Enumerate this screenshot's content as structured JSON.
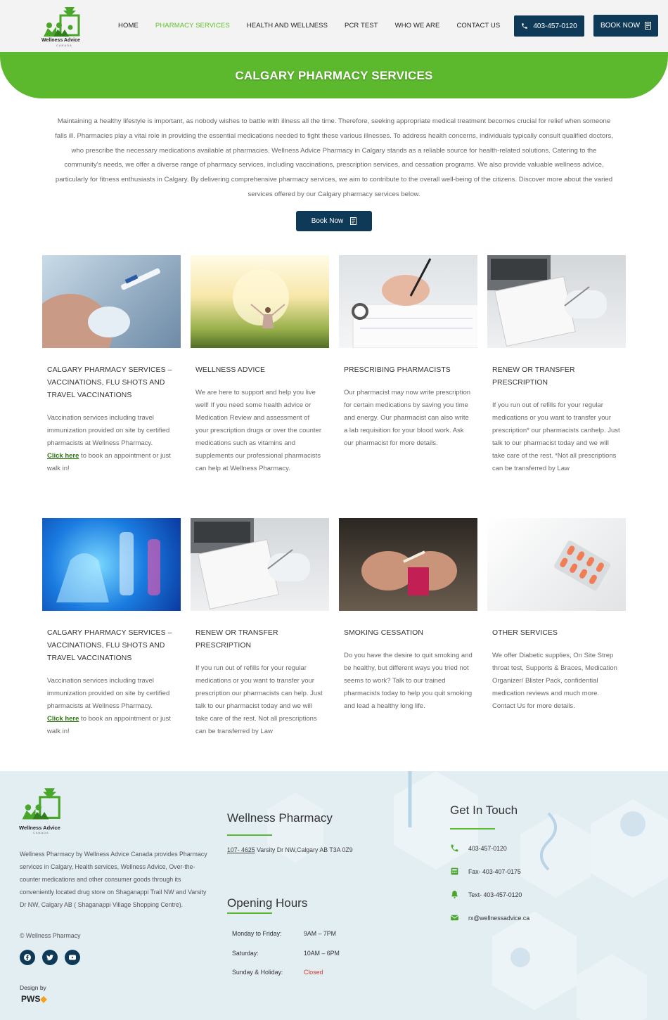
{
  "header": {
    "brand": "Wellness Advice",
    "brand_sub": "CANADA",
    "nav": [
      {
        "label": "HOME"
      },
      {
        "label": "PHARMACY SERVICES"
      },
      {
        "label": "HEALTH AND WELLNESS"
      },
      {
        "label": "PCR TEST"
      },
      {
        "label": "WHO WE ARE"
      },
      {
        "label": "CONTACT US"
      }
    ],
    "active_nav": "PHARMACY SERVICES",
    "phone_label": "403-457-0120",
    "book_label": "BOOK NOW"
  },
  "banner": {
    "title": "CALGARY PHARMACY SERVICES"
  },
  "intro": {
    "text": "Maintaining a healthy lifestyle is important, as nobody wishes to battle with illness all the time. Therefore, seeking appropriate medical treatment becomes crucial for relief when someone falls ill. Pharmacies play a vital role in providing the essential medications needed to fight these various illnesses. To address health concerns, individuals typically consult qualified doctors, who prescribe the necessary medications available at pharmacies. Wellness Advice Pharmacy in Calgary stands as a reliable source for health-related solutions. Catering to the community's needs, we offer a diverse range of pharmacy services, including vaccinations, prescription services, and cessation programs. We also provide valuable wellness advice, particularly for fitness enthusiasts in Calgary. By delivering comprehensive pharmacy services, we aim to contribute to the overall well-being of the citizens. Discover more about the varied services offered by our Calgary pharmacy services below.",
    "button_label": "Book Now"
  },
  "cards": [
    {
      "title": "CALGARY PHARMACY SERVICES – VACCINATIONS, FLU SHOTS AND TRAVEL VACCINATIONS",
      "text": "Vaccination services including travel immunization provided on site by certified pharmacists at Wellness Pharmacy.",
      "link": "Click here",
      "after": " to book an appointment or just walk in!"
    },
    {
      "title": "WELLNESS ADVICE",
      "text": "We are here to support and help you live well! If you need some health advice or Medication Review and assessment of your prescription drugs or over the counter medications such as vitamins and supplements our professional pharmacists can help at Wellness Pharmacy."
    },
    {
      "title": "PRESCRIBING PHARMACISTS",
      "text": "Our pharmacist may now write prescription for certain medications by saving you time and energy. Our pharmacist can also write a lab requisition for your blood work. Ask our pharmacist for more details."
    },
    {
      "title": "RENEW OR TRANSFER PRESCRIPTION",
      "text": "If you run out of refills for your regular medications or you want to transfer your prescription* our pharmacists canhelp. Just talk to our pharmacist today and we will take care of the rest. *Not all prescriptions can be transferred by Law"
    },
    {
      "title": "CALGARY PHARMACY SERVICES – VACCINATIONS, FLU SHOTS AND TRAVEL VACCINATIONS",
      "text": "Vaccination services including travel immunization provided on site by certified pharmacists at Wellness Pharmacy.",
      "link": "Click here",
      "after": " to book an appointment or just walk in!"
    },
    {
      "title": "RENEW OR TRANSFER PRESCRIPTION",
      "text": "If you run out of refills for your regular medications or you want to transfer your prescription our pharmacists can help.  Just talk to our pharmacist today and we will take care of the rest. Not all prescriptions can be transferred by Law"
    },
    {
      "title": "SMOKING CESSATION",
      "text": "Do you have the desire to quit smoking and be healthy, but different ways you tried not seems to work? Talk to our trained pharmacists today to help you quit smoking and lead a healthy long life."
    },
    {
      "title": "OTHER SERVICES",
      "text": "We offer Diabetic supplies, On Site Strep throat test, Supports & Braces, Medication Organizer/ Blister Pack, confidential medication reviews and much more. Contact Us for more details."
    }
  ],
  "footer": {
    "brand": "Wellness Advice",
    "brand_sub": "CANADA",
    "about": "Wellness Pharmacy by Wellness Advice Canada provides Pharmacy services in Calgary, Health services, Wellness Advice, Over-the-counter medications and other consumer goods through its conveniently located drug store on Shaganappi Trail NW and Varsity Dr NW, Calgary AB ( Shaganappi Village Shopping Centre).",
    "copyright": "© Wellness Pharmacy",
    "design_by": "Design by",
    "designer": "PWS",
    "pharmacy_title": "Wellness Pharmacy",
    "address_num": "107- 4625",
    "address_rest": " Varsity Dr NW,Calgary AB T3A 0Z9",
    "hours_title": "Opening Hours",
    "hours": [
      {
        "day": "Monday to Friday:",
        "time": "9AM – 7PM"
      },
      {
        "day": "Saturday:",
        "time": "10AM – 6PM"
      },
      {
        "day": "Sunday & Holiday:",
        "time": "Closed"
      }
    ],
    "contact_title": "Get In Touch",
    "contacts": [
      {
        "icon": "phone-icon",
        "text": "403-457-0120"
      },
      {
        "icon": "fax-icon",
        "text": "Fax- 403-407-0175"
      },
      {
        "icon": "bell-icon",
        "text": "Text- 403-457-0120"
      },
      {
        "icon": "email-icon",
        "text": "rx@wellnessadvice.ca"
      }
    ]
  },
  "colors": {
    "brand_green": "#5cb82c",
    "navy": "#0f3a57",
    "closed_red": "#d03636"
  }
}
